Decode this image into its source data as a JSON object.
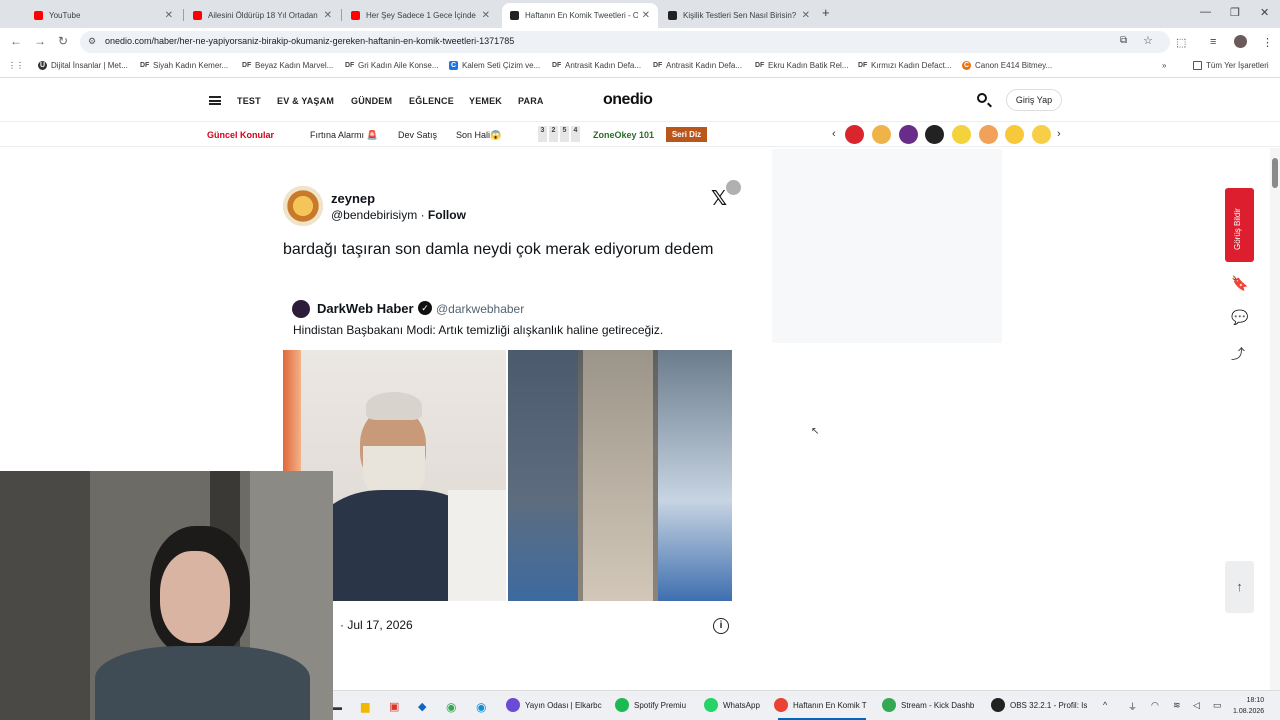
{
  "tabs": [
    {
      "title": "YouTube",
      "color": "#ff0000"
    },
    {
      "title": "Ailesini Öldürüp 18 Yıl Ortadan",
      "color": "#ff0000"
    },
    {
      "title": "Her Şey Sadece 1 Gece İçinde O",
      "color": "#ff0000"
    },
    {
      "title": "Haftanın En Komik Tweetleri - O",
      "color": "#222222"
    },
    {
      "title": "Kişilik Testleri Sen Nasıl Birisin?",
      "color": "#222222"
    }
  ],
  "address": {
    "url": "onedio.com/haber/her-ne-yapiyorsaniz-birakip-okumaniz-gereken-haftanin-en-komik-tweetleri-1371785"
  },
  "bookmarks": [
    {
      "label": "Dijital İnsanlar | Met...",
      "icon": "U"
    },
    {
      "label": "Siyah Kadın Kemer...",
      "icon": "DF"
    },
    {
      "label": "Beyaz Kadın Marvel...",
      "icon": "DF"
    },
    {
      "label": "Gri Kadın Aile Konse...",
      "icon": "DF"
    },
    {
      "label": "Kalem Seti Çizim ve...",
      "icon": "C"
    },
    {
      "label": "Antrasit Kadın Defa...",
      "icon": "DF"
    },
    {
      "label": "Antrasit Kadın Defa...",
      "icon": "DF"
    },
    {
      "label": "Ekru Kadın Batik Rel...",
      "icon": "DF"
    },
    {
      "label": "Kırmızı Kadın Defact...",
      "icon": "DF"
    },
    {
      "label": "Canon E414 Bitmey...",
      "icon": "C"
    }
  ],
  "bookmarks_all": "Tüm Yer İşaretleri",
  "site": {
    "logo": "onedio",
    "nav": [
      "TEST",
      "EV & YAŞAM",
      "GÜNDEM",
      "EĞLENCE",
      "YEMEK",
      "PARA"
    ],
    "login": "Giriş Yap",
    "sub": {
      "current": "Güncel Konular",
      "links": [
        "Fırtına Alarmı 🚨",
        "Dev Satış",
        "Son Hali😱"
      ],
      "numbers": [
        "3",
        "2",
        "5",
        "4"
      ],
      "zone": "ZoneOkey 101",
      "serili": "Seri Diz"
    }
  },
  "tweet": {
    "name": "zeynep",
    "handle": "@bendebirisiym",
    "follow": "Follow",
    "text": "bardağı taşıran son damla neydi çok merak ediyorum dedem",
    "quote": {
      "name": "DarkWeb Haber",
      "handle": "@darkwebhaber",
      "text": "Hindistan Başbakanı Modi: Artık temizliği alışkanlık haline getireceğiz."
    },
    "date": "· Jul 17, 2026"
  },
  "side": {
    "feedback": "Görüş Bildir"
  },
  "taskbar": {
    "apps": [
      {
        "label": "Yayın Odası | Elkarbc",
        "color": "#6b4bd6"
      },
      {
        "label": "Spotify Premiu",
        "color": "#1db954"
      },
      {
        "label": "WhatsApp",
        "color": "#25d366"
      },
      {
        "label": "Haftanın En Komik T",
        "color": "#ea4335"
      },
      {
        "label": "Stream - Kick Dashb",
        "color": "#34a853"
      },
      {
        "label": "OBS 32.2.1 - Profil: Is",
        "color": "#222222"
      }
    ],
    "time": "18:10",
    "date": "1.08.2026"
  }
}
